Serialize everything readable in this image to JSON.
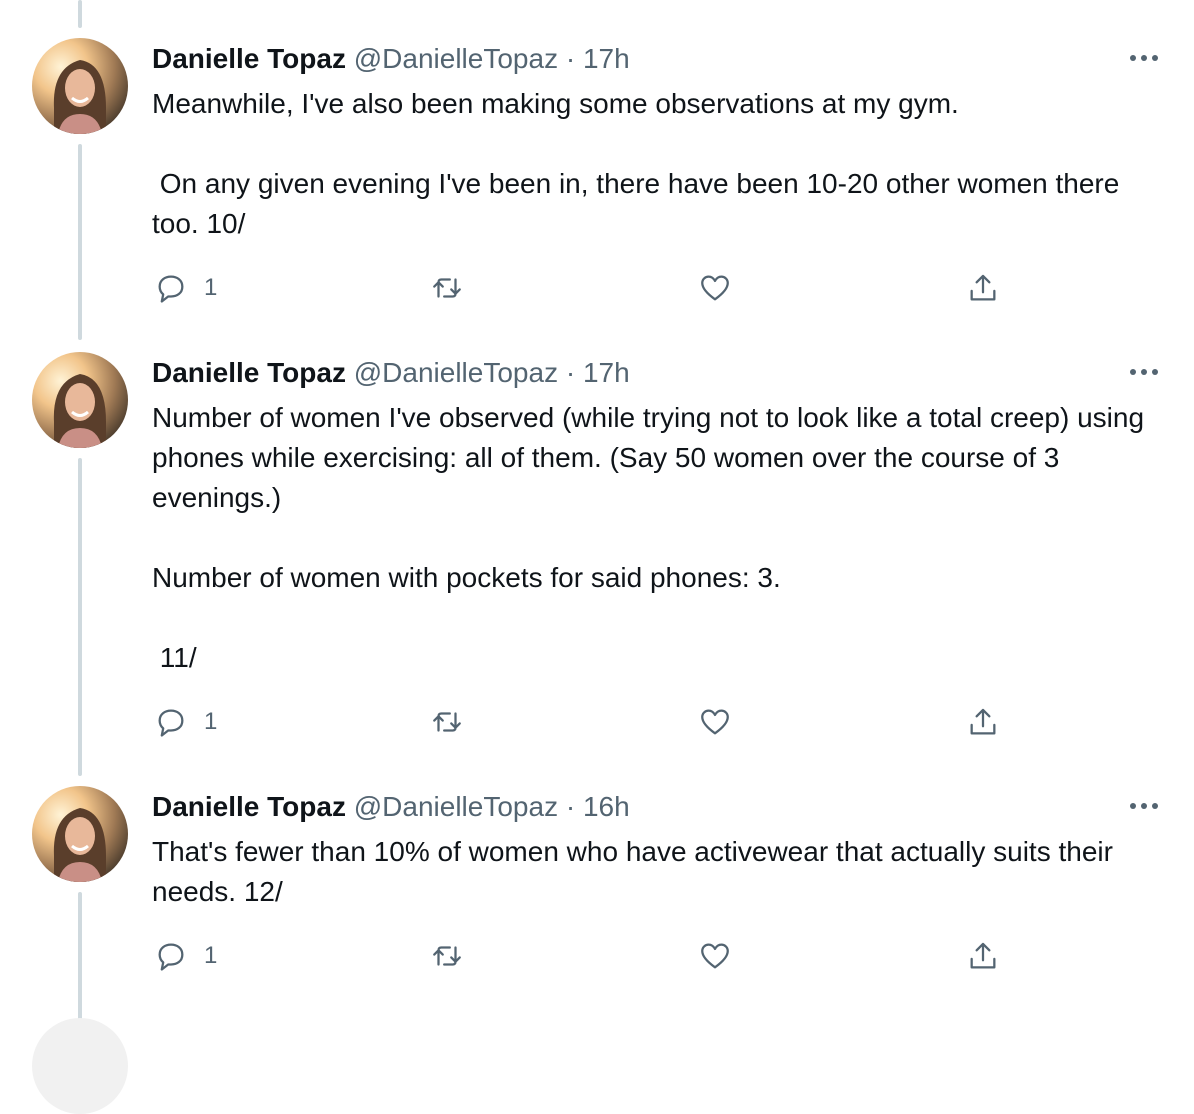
{
  "tweets": [
    {
      "name": "Danielle Topaz",
      "handle": "@DanielleTopaz",
      "separator": "·",
      "time": "17h",
      "text": "Meanwhile, I've also been making some observations at my gym.\n\n On any given evening I've been in, there have been 10-20 other women there too. 10/",
      "reply_count": "1",
      "retweet_count": "",
      "like_count": ""
    },
    {
      "name": "Danielle Topaz",
      "handle": "@DanielleTopaz",
      "separator": "·",
      "time": "17h",
      "text": "Number of women I've observed (while trying not to look like a total creep) using phones while exercising: all of them. (Say 50 women over the course of 3 evenings.)\n\nNumber of women with pockets for said phones: 3.\n\n 11/",
      "reply_count": "1",
      "retweet_count": "",
      "like_count": ""
    },
    {
      "name": "Danielle Topaz",
      "handle": "@DanielleTopaz",
      "separator": "·",
      "time": "16h",
      "text": "That's fewer than 10% of women who have activewear that actually suits their needs. 12/",
      "reply_count": "1",
      "retweet_count": "",
      "like_count": ""
    }
  ],
  "icons": {
    "more": "more-horizontal-icon",
    "reply": "reply-icon",
    "retweet": "retweet-icon",
    "like": "heart-icon",
    "share": "share-icon"
  },
  "colors": {
    "text_primary": "#0f1419",
    "text_secondary": "#536471",
    "thread_line": "#cfd9de"
  }
}
